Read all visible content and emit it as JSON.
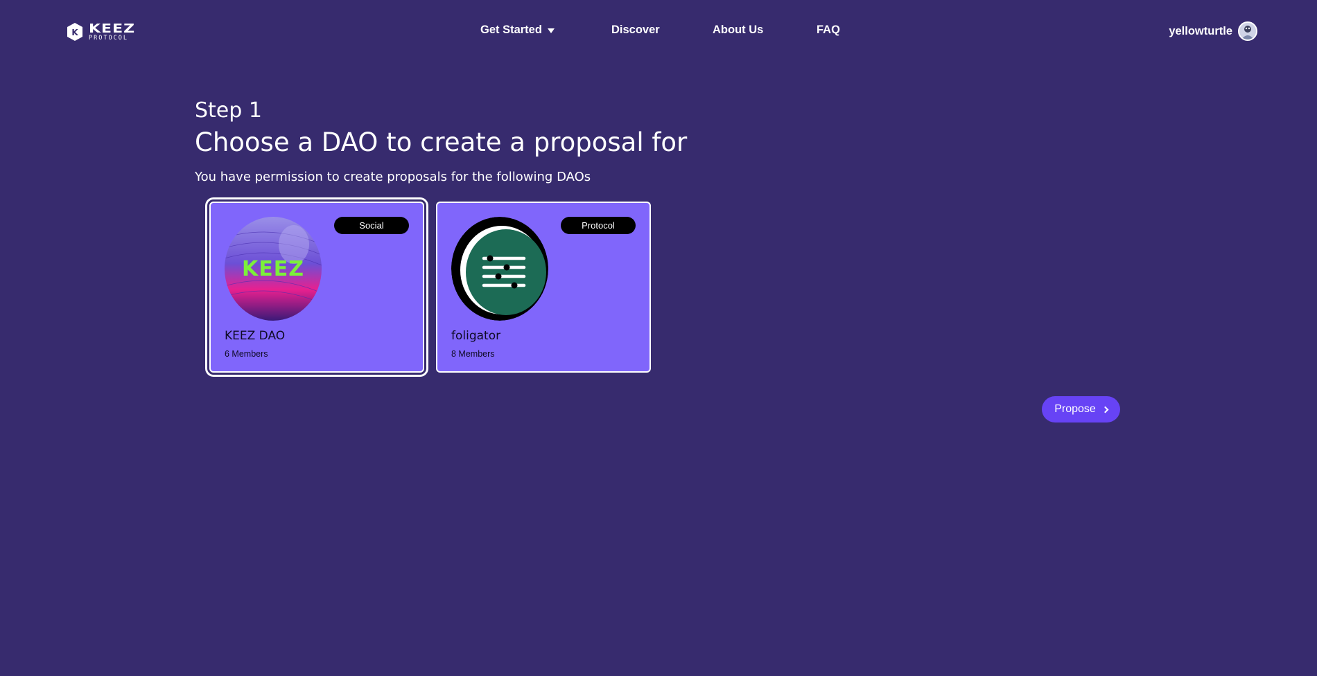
{
  "header": {
    "logo": {
      "word": "KEEZ",
      "sub": "PROTOCOL"
    },
    "nav": [
      {
        "label": "Get Started"
      },
      {
        "label": "Discover"
      },
      {
        "label": "About Us"
      },
      {
        "label": "FAQ"
      }
    ],
    "user": {
      "name": "yellowturtle",
      "avatar_icon": "user-avatar"
    }
  },
  "main": {
    "step": "Step 1",
    "title": "Choose a DAO to create a proposal for",
    "subtitle": "You have permission to create proposals for the following DAOs",
    "daos": [
      {
        "name": "KEEZ DAO",
        "members": "6 Members",
        "tag": "Social",
        "selected": true,
        "image_icon": "keez-dao-image"
      },
      {
        "name": "foligator",
        "members": "8 Members",
        "tag": "Protocol",
        "selected": false,
        "image_icon": "foligator-image"
      }
    ],
    "propose_label": "Propose"
  },
  "colors": {
    "background": "#372b6e",
    "card": "#8066fb",
    "button": "#6743f5",
    "tag": "#000000"
  }
}
